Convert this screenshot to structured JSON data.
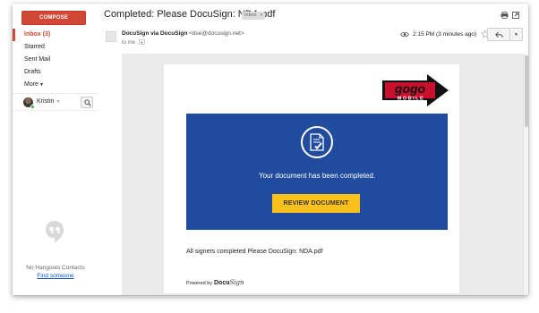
{
  "sidebar": {
    "compose_label": "COMPOSE",
    "items": [
      {
        "label": "Inbox (3)",
        "active": true
      },
      {
        "label": "Starred"
      },
      {
        "label": "Sent Mail"
      },
      {
        "label": "Drafts"
      },
      {
        "label": "More"
      }
    ],
    "user_name": "Kristin",
    "hangouts_empty": "No Hangouts Contacts",
    "find_someone": "Find someone"
  },
  "header": {
    "subject": "Completed: Please DocuSign: NDA.pdf",
    "label_chip": "Inbox",
    "label_chip_close": "x"
  },
  "message": {
    "sender_name": "DocuSign via DocuSign",
    "sender_email": "<dse@docusign.net>",
    "to": "to me",
    "time": "2:15 PM (3 minutes ago)",
    "icons": [
      "eye-icon",
      "star-icon",
      "reply-icon",
      "chevron-down-icon",
      "print-icon",
      "popout-icon"
    ]
  },
  "email": {
    "logo_text_top": "gogo",
    "logo_text_bottom": "MOBILE",
    "banner_text": "Your document has been completed.",
    "button_label": "REVIEW DOCUMENT",
    "signers_text": "All signers completed Please DocuSign: NDA.pdf",
    "powered_by": "Powered by",
    "brand_docu": "Docu",
    "brand_sign": "Sign"
  },
  "colors": {
    "compose": "#d14836",
    "banner": "#214b9d",
    "button": "#fcc01d",
    "link": "#1155cc",
    "logo_red": "#c8102e"
  }
}
